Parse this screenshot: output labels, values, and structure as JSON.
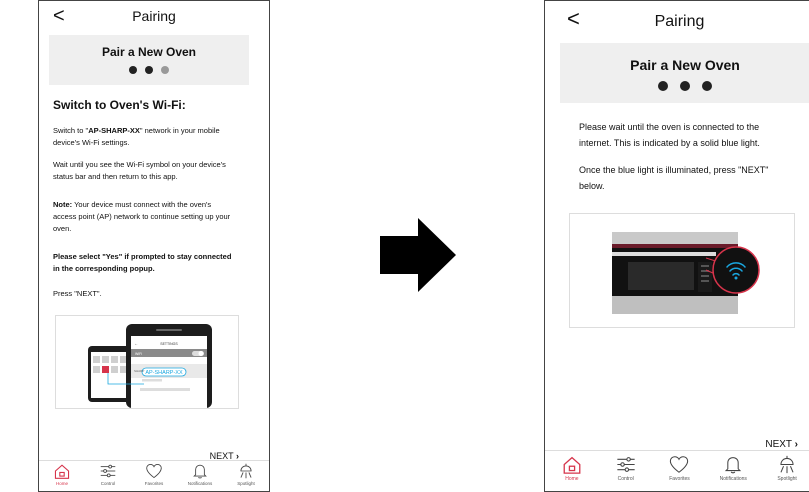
{
  "left": {
    "header": {
      "back": "<",
      "title": "Pairing"
    },
    "banner": {
      "title": "Pair a New Oven",
      "step": 2,
      "total_steps": 3
    },
    "section_title": "Switch to Oven's Wi-Fi:",
    "p1_pre": "Switch to \"",
    "p1_bold": "AP-SHARP-XX",
    "p1_post": "\" network in your mobile device's Wi-Fi settings.",
    "p2": "Wait until you see the Wi-Fi symbol on your device's status bar and then return to this app.",
    "p3_bold": "Note:",
    "p3_rest": " Your device must connect with the oven's access point (AP) network to continue setting up your oven.",
    "p4": "Please select \"Yes\" if prompted to stay connected in the corresponding popup.",
    "p5": "Press \"NEXT\".",
    "illustration": {
      "settings": "SETTINGS",
      "network": "AP-SHARP-XX",
      "wifi_label": "WiFi",
      "sharp_label": "SHARP"
    },
    "next": "NEXT"
  },
  "right": {
    "header": {
      "back": "<",
      "title": "Pairing"
    },
    "banner": {
      "title": "Pair a New Oven",
      "step": 3,
      "total_steps": 3
    },
    "p1": "Please wait until the oven is connected to the internet.  This is indicated by a solid blue light.",
    "p2": "Once the blue light is illuminated, press \"NEXT\" below.",
    "next": "NEXT"
  },
  "tabs": [
    {
      "label": "Home",
      "icon": "home-icon",
      "active": true
    },
    {
      "label": "Control",
      "icon": "sliders-icon",
      "active": false
    },
    {
      "label": "Favorites",
      "icon": "heart-icon",
      "active": false
    },
    {
      "label": "Notifications",
      "icon": "bell-icon",
      "active": false
    },
    {
      "label": "Spotlight",
      "icon": "spotlight-icon",
      "active": false
    }
  ],
  "colors": {
    "accent": "#d6344b",
    "wifi_blue": "#1aa7e0",
    "banner_bg": "#efefef"
  }
}
